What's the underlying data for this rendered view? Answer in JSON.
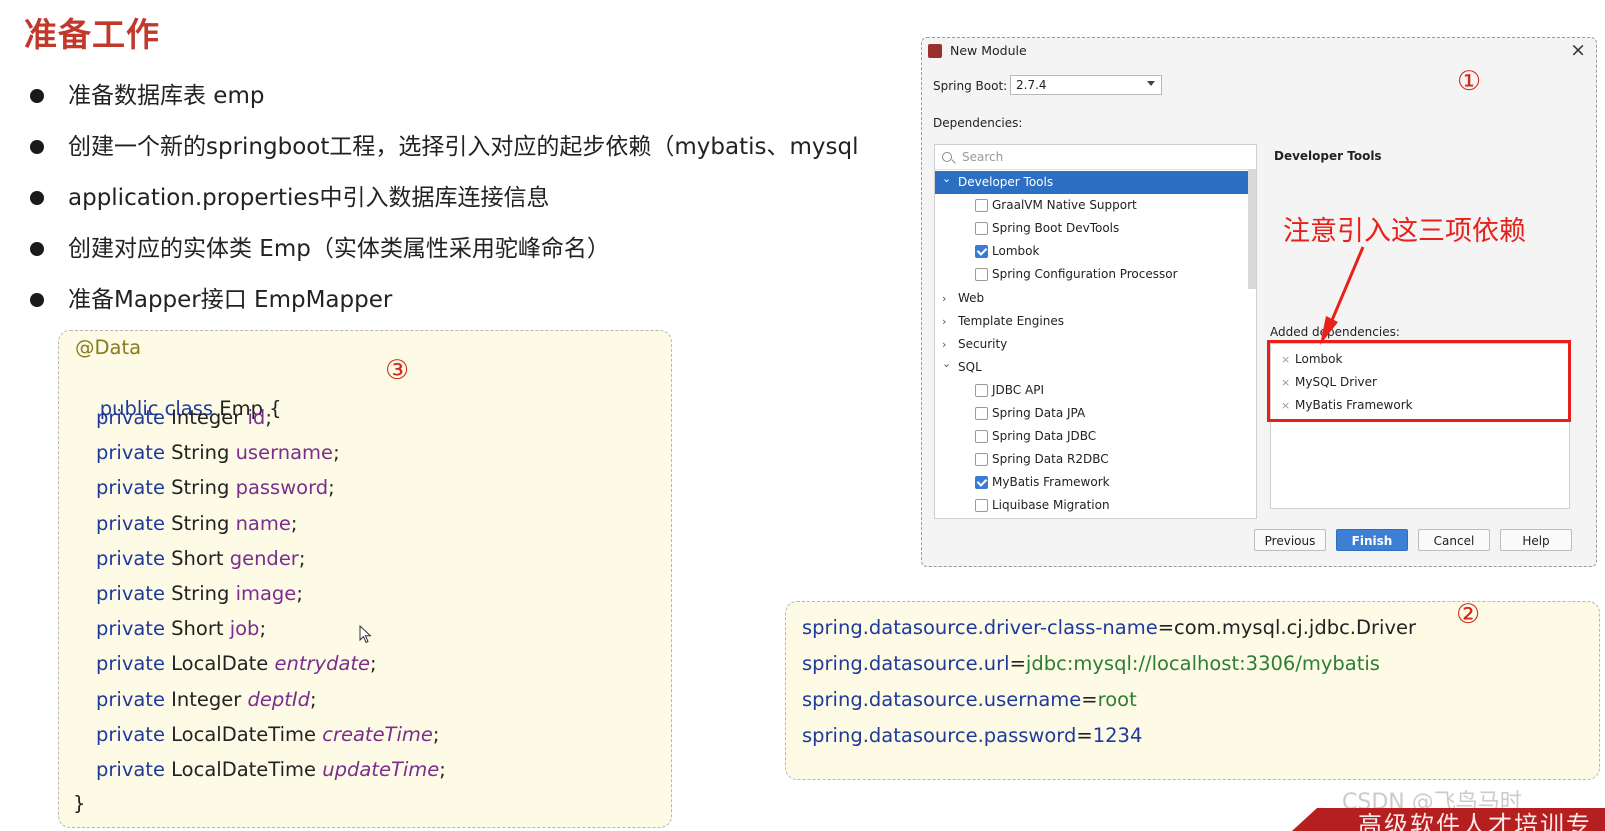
{
  "slide": {
    "title": "准备工作",
    "bullets": [
      "准备数据库表 emp",
      "创建一个新的springboot工程，选择引入对应的起步依赖（mybatis、mysql",
      "application.properties中引入数据库连接信息",
      "创建对应的实体类 Emp（实体类属性采用驼峰命名）",
      "准备Mapper接口 EmpMapper"
    ]
  },
  "code": {
    "annotation": "@Data",
    "class_kw": "public class",
    "class_name": "Emp {",
    "fields": [
      {
        "kw": "private",
        "type": "Integer",
        "name": "id"
      },
      {
        "kw": "private",
        "type": "String",
        "name": "username"
      },
      {
        "kw": "private",
        "type": "String",
        "name": "password"
      },
      {
        "kw": "private",
        "type": "String",
        "name": "name"
      },
      {
        "kw": "private",
        "type": "Short",
        "name": "gender"
      },
      {
        "kw": "private",
        "type": "String",
        "name": "image"
      },
      {
        "kw": "private",
        "type": "Short",
        "name": "job"
      },
      {
        "kw": "private",
        "type": "LocalDate",
        "name": "entrydate"
      },
      {
        "kw": "private",
        "type": "Integer",
        "name": "deptId"
      },
      {
        "kw": "private",
        "type": "LocalDateTime",
        "name": "createTime"
      },
      {
        "kw": "private",
        "type": "LocalDateTime",
        "name": "updateTime"
      }
    ],
    "semicolon": ";",
    "closing": "}",
    "marker": "③"
  },
  "dialog": {
    "title": "New Module",
    "close": "×",
    "springboot_label": "Spring Boot:",
    "springboot_version": "2.7.4",
    "dependencies_label": "Dependencies:",
    "search_placeholder": "Search",
    "tree": [
      {
        "label": "Developer Tools",
        "kind": "group",
        "expanded": true,
        "selected": true
      },
      {
        "label": "GraalVM Native Support",
        "kind": "item",
        "checked": false
      },
      {
        "label": "Spring Boot DevTools",
        "kind": "item",
        "checked": false
      },
      {
        "label": "Lombok",
        "kind": "item",
        "checked": true
      },
      {
        "label": "Spring Configuration Processor",
        "kind": "item",
        "checked": false
      },
      {
        "label": "Web",
        "kind": "group",
        "expanded": false
      },
      {
        "label": "Template Engines",
        "kind": "group",
        "expanded": false
      },
      {
        "label": "Security",
        "kind": "group",
        "expanded": false
      },
      {
        "label": "SQL",
        "kind": "group",
        "expanded": true
      },
      {
        "label": "JDBC API",
        "kind": "item",
        "checked": false
      },
      {
        "label": "Spring Data JPA",
        "kind": "item",
        "checked": false
      },
      {
        "label": "Spring Data JDBC",
        "kind": "item",
        "checked": false
      },
      {
        "label": "Spring Data R2DBC",
        "kind": "item",
        "checked": false
      },
      {
        "label": "MyBatis Framework",
        "kind": "item",
        "checked": true
      },
      {
        "label": "Liquibase Migration",
        "kind": "item",
        "checked": false
      }
    ],
    "right_heading": "Developer Tools",
    "added_label": "Added dependencies:",
    "added": [
      "Lombok",
      "MySQL Driver",
      "MyBatis Framework"
    ],
    "remove_glyph": "×",
    "buttons": {
      "previous": "Previous",
      "finish": "Finish",
      "cancel": "Cancel",
      "help": "Help"
    },
    "marker": "①",
    "accent": "#2d6fc0"
  },
  "annotation_note": "注意引入这三项依赖",
  "properties": {
    "lines": [
      {
        "key": "spring.datasource.driver-class-name",
        "value": "com.mysql.cj.jdbc.Driver"
      },
      {
        "key": "spring.datasource.url",
        "value": "jdbc:mysql://localhost:3306/mybatis"
      },
      {
        "key": "spring.datasource.username",
        "value": "root"
      },
      {
        "key": "spring.datasource.password",
        "value": "1234"
      }
    ],
    "equals": "=",
    "marker": "②"
  },
  "footer": {
    "banner_text": "高级软件人才培训专",
    "watermark": "CSDN @飞鸟马时"
  },
  "colors": {
    "title_red": "#c0392b",
    "highlight_red": "#e8201a",
    "code_bg": "#fdfbe6"
  }
}
